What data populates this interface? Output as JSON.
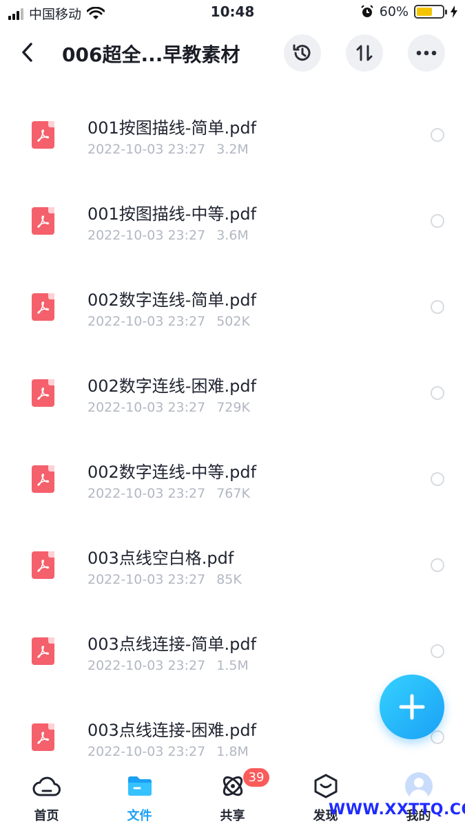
{
  "status_bar": {
    "carrier": "中国移动",
    "time": "10:48",
    "battery_percent": "60%",
    "battery_level": 0.6,
    "icons": [
      "signal-icon",
      "wifi-icon",
      "alarm-icon",
      "battery-icon",
      "charging-icon"
    ]
  },
  "header": {
    "title": "006超全...早教素材",
    "buttons": [
      "back-icon",
      "history-icon",
      "sort-icon",
      "more-icon"
    ]
  },
  "files": [
    {
      "name": "001按图描线-简单.pdf",
      "date": "2022-10-03 23:27",
      "size": "3.2M"
    },
    {
      "name": "001按图描线-中等.pdf",
      "date": "2022-10-03 23:27",
      "size": "3.6M"
    },
    {
      "name": "002数字连线-简单.pdf",
      "date": "2022-10-03 23:27",
      "size": "502K"
    },
    {
      "name": "002数字连线-困难.pdf",
      "date": "2022-10-03 23:27",
      "size": "729K"
    },
    {
      "name": "002数字连线-中等.pdf",
      "date": "2022-10-03 23:27",
      "size": "767K"
    },
    {
      "name": "003点线空白格.pdf",
      "date": "2022-10-03 23:27",
      "size": "85K"
    },
    {
      "name": "003点线连接-简单.pdf",
      "date": "2022-10-03 23:27",
      "size": "1.5M"
    },
    {
      "name": "003点线连接-困难.pdf",
      "date": "2022-10-03 23:27",
      "size": "1.8M"
    }
  ],
  "fab": {
    "icon": "plus-icon"
  },
  "tabs": [
    {
      "label": "首页",
      "icon": "cloud-icon",
      "active": false
    },
    {
      "label": "文件",
      "icon": "folder-icon",
      "active": true
    },
    {
      "label": "共享",
      "icon": "share-orbit-icon",
      "active": false,
      "badge": "39"
    },
    {
      "label": "发现",
      "icon": "discover-icon",
      "active": false
    },
    {
      "label": "我的",
      "icon": "avatar-icon",
      "active": false
    }
  ],
  "watermark": "WWW.XXTTQ.COM",
  "colors": {
    "accent": "#1aa0f5",
    "pdf": "#f4606b",
    "badge": "#fb5b5b",
    "meta_text": "#b2b7c2",
    "watermark": "#1f2bff"
  }
}
